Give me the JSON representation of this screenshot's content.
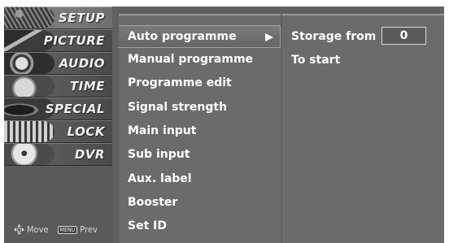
{
  "categories": [
    {
      "label": "SETUP",
      "icon": "setup-thumbnail-icon",
      "selected": true
    },
    {
      "label": "PICTURE",
      "icon": "picture-thumbnail-icon",
      "selected": false
    },
    {
      "label": "AUDIO",
      "icon": "audio-thumbnail-icon",
      "selected": false
    },
    {
      "label": "TIME",
      "icon": "time-thumbnail-icon",
      "selected": false
    },
    {
      "label": "SPECIAL",
      "icon": "special-thumbnail-icon",
      "selected": false
    },
    {
      "label": "LOCK",
      "icon": "lock-thumbnail-icon",
      "selected": false
    },
    {
      "label": "DVR",
      "icon": "dvr-thumbnail-icon",
      "selected": false
    }
  ],
  "hints": {
    "move_label": "Move",
    "menu_key_label": "MENU",
    "prev_label": "Prev"
  },
  "menu": {
    "items": [
      {
        "label": "Auto programme",
        "selected": true
      },
      {
        "label": "Manual programme",
        "selected": false
      },
      {
        "label": "Programme edit",
        "selected": false
      },
      {
        "label": "Signal strength",
        "selected": false
      },
      {
        "label": "Main input",
        "selected": false
      },
      {
        "label": "Sub input",
        "selected": false
      },
      {
        "label": "Aux. label",
        "selected": false
      },
      {
        "label": "Booster",
        "selected": false
      },
      {
        "label": "Set ID",
        "selected": false
      }
    ]
  },
  "detail": {
    "storage_label": "Storage from",
    "storage_value": "0",
    "start_label": "To start"
  },
  "colors": {
    "panel": "#6b6b6b",
    "sidebar": "#5a5a5a",
    "text": "#ffffff"
  }
}
